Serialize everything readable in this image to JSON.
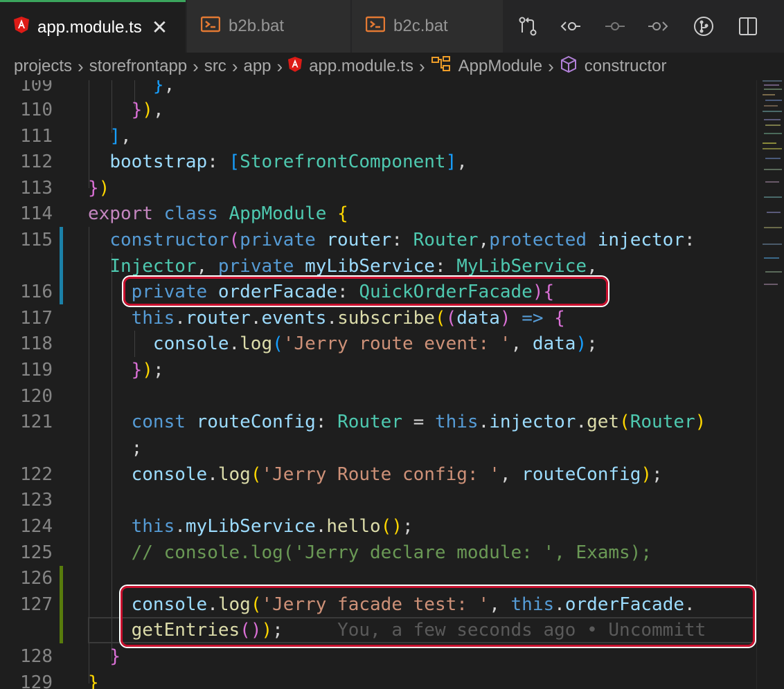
{
  "tabs": [
    {
      "label": "app.module.ts",
      "icon": "angular-icon",
      "active": true
    },
    {
      "label": "b2b.bat",
      "icon": "terminal-file-icon",
      "active": false
    },
    {
      "label": "b2c.bat",
      "icon": "terminal-file-icon",
      "active": false
    }
  ],
  "toolbar": {
    "icons": [
      "open-changes-icon",
      "go-back-commit-icon",
      "commit-icon",
      "go-forward-commit-icon",
      "git-lens-icon",
      "split-editor-icon"
    ]
  },
  "breadcrumb": {
    "items": [
      "projects",
      "storefrontapp",
      "src",
      "app",
      "app.module.ts",
      "AppModule",
      "constructor"
    ]
  },
  "editor": {
    "line_numbers": [
      "109",
      "110",
      "111",
      "112",
      "113",
      "114",
      "115",
      "",
      "116",
      "117",
      "118",
      "119",
      "120",
      "121",
      "",
      "122",
      "123",
      "124",
      "125",
      "126",
      "127",
      "",
      "128",
      "129"
    ],
    "blame": "You, a few seconds ago • Uncommitt"
  },
  "colors": {
    "accent_tab_border": "#3ba55d",
    "highlight_box": "#c8102e",
    "gutter_modified": "#1b81a8",
    "gutter_added": "#587c0c"
  }
}
